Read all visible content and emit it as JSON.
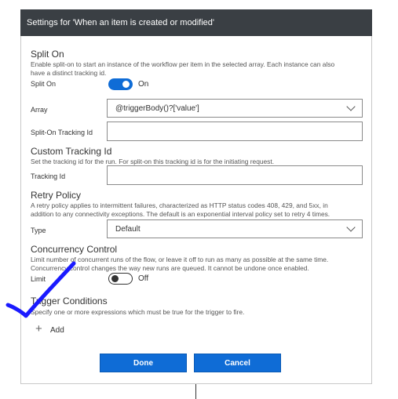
{
  "header": {
    "title": "Settings for 'When an item is created or modified'"
  },
  "split_on": {
    "title": "Split On",
    "desc_line1": "Enable split-on to start an instance of the workflow per item in the selected array. Each instance can also",
    "desc_line2": "have a distinct tracking id.",
    "toggle_label": "Split On",
    "toggle_state": "On",
    "array_label": "Array",
    "array_value": "@triggerBody()?['value']",
    "tracking_label": "Split-On Tracking Id",
    "tracking_value": ""
  },
  "custom_tracking": {
    "title": "Custom Tracking Id",
    "desc": "Set the tracking id for the run. For split-on this tracking id is for the initiating request.",
    "label": "Tracking Id",
    "value": ""
  },
  "retry": {
    "title": "Retry Policy",
    "desc_line1": "A retry policy applies to intermittent failures, characterized as HTTP status codes 408, 429, and 5xx, in",
    "desc_line2": "addition to any connectivity exceptions. The default is an exponential interval policy set to retry 4 times.",
    "type_label": "Type",
    "type_value": "Default"
  },
  "concurrency": {
    "title": "Concurrency Control",
    "desc_line1": "Limit number of concurrent runs of the flow, or leave it off to run as many as possible at the same time.",
    "desc_line2": "Concurrency control changes the way new runs are queued. It cannot be undone once enabled.",
    "limit_label": "Limit",
    "toggle_state": "Off"
  },
  "trigger_conditions": {
    "title": "Trigger Conditions",
    "desc": "Specify one or more expressions which must be true for the trigger to fire.",
    "add_label": "Add"
  },
  "buttons": {
    "done": "Done",
    "cancel": "Cancel"
  },
  "colors": {
    "accent": "#0f6cd6",
    "header_bg": "#3a3f44",
    "annotation": "#1a1aff"
  }
}
